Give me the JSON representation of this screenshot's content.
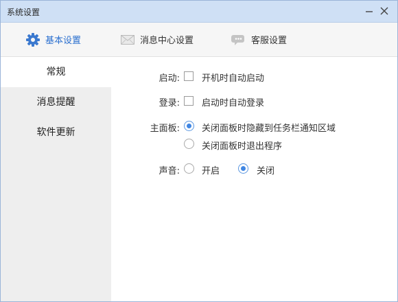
{
  "window": {
    "title": "系统设置"
  },
  "top_tabs": [
    {
      "label": "基本设置",
      "icon": "gear-icon",
      "active": true
    },
    {
      "label": "消息中心设置",
      "icon": "envelope-icon",
      "active": false
    },
    {
      "label": "客服设置",
      "icon": "chat-bubble-icon",
      "active": false
    }
  ],
  "sidebar": {
    "items": [
      {
        "label": "常规",
        "active": true
      },
      {
        "label": "消息提醒",
        "active": false
      },
      {
        "label": "软件更新",
        "active": false
      }
    ]
  },
  "settings": {
    "startup": {
      "label": "启动:",
      "option": "开机时自动启动",
      "checked": false
    },
    "login": {
      "label": "登录:",
      "option": "启动时自动登录",
      "checked": false
    },
    "main_panel": {
      "label": "主面板:",
      "options": [
        {
          "text": "关闭面板时隐藏到任务栏通知区域",
          "selected": true
        },
        {
          "text": "关闭面板时退出程序",
          "selected": false
        }
      ]
    },
    "sound": {
      "label": "声音:",
      "options": [
        {
          "text": "开启",
          "selected": false
        },
        {
          "text": "关闭",
          "selected": true
        }
      ]
    }
  },
  "colors": {
    "titlebar": "#cfe0f5",
    "accent": "#2a6fcf",
    "sidebar_bg": "#eeeeee",
    "radio_dot": "#3f86e3"
  }
}
